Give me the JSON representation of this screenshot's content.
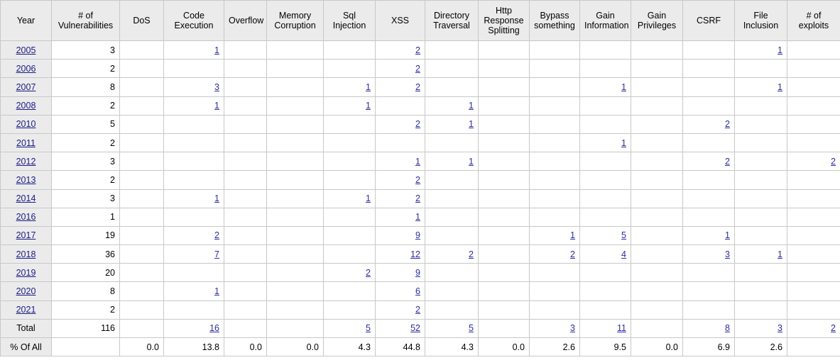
{
  "table": {
    "columns": [
      "Year",
      "# of Vulnerabilities",
      "DoS",
      "Code Execution",
      "Overflow",
      "Memory Corruption",
      "Sql Injection",
      "XSS",
      "Directory Traversal",
      "Http Response Splitting",
      "Bypass something",
      "Gain Information",
      "Gain Privileges",
      "CSRF",
      "File Inclusion",
      "# of exploits"
    ],
    "total_label": "Total",
    "percent_label": "% Of All",
    "link_color": "#2a2ab0",
    "year_link_color": "#1a1a8c",
    "header_bg": "#ebebeb",
    "border_color": "#c8c8c8",
    "rows": [
      {
        "year": "2005",
        "year_link": true,
        "cells": [
          "3",
          "",
          "1",
          "",
          "",
          "",
          "2",
          "",
          "",
          "",
          "",
          "",
          "",
          "1",
          ""
        ],
        "link_flags": [
          false,
          false,
          true,
          false,
          false,
          false,
          true,
          false,
          false,
          false,
          false,
          false,
          false,
          true,
          false
        ]
      },
      {
        "year": "2006",
        "year_link": true,
        "cells": [
          "2",
          "",
          "",
          "",
          "",
          "",
          "2",
          "",
          "",
          "",
          "",
          "",
          "",
          "",
          ""
        ],
        "link_flags": [
          false,
          false,
          false,
          false,
          false,
          false,
          true,
          false,
          false,
          false,
          false,
          false,
          false,
          false,
          false
        ]
      },
      {
        "year": "2007",
        "year_link": true,
        "cells": [
          "8",
          "",
          "3",
          "",
          "",
          "1",
          "2",
          "",
          "",
          "",
          "1",
          "",
          "",
          "1",
          ""
        ],
        "link_flags": [
          false,
          false,
          true,
          false,
          false,
          true,
          true,
          false,
          false,
          false,
          true,
          false,
          false,
          true,
          false
        ]
      },
      {
        "year": "2008",
        "year_link": true,
        "cells": [
          "2",
          "",
          "1",
          "",
          "",
          "1",
          "",
          "1",
          "",
          "",
          "",
          "",
          "",
          "",
          ""
        ],
        "link_flags": [
          false,
          false,
          true,
          false,
          false,
          true,
          false,
          true,
          false,
          false,
          false,
          false,
          false,
          false,
          false
        ]
      },
      {
        "year": "2010",
        "year_link": true,
        "cells": [
          "5",
          "",
          "",
          "",
          "",
          "",
          "2",
          "1",
          "",
          "",
          "",
          "",
          "2",
          "",
          ""
        ],
        "link_flags": [
          false,
          false,
          false,
          false,
          false,
          false,
          true,
          true,
          false,
          false,
          false,
          false,
          true,
          false,
          false
        ]
      },
      {
        "year": "2011",
        "year_link": true,
        "cells": [
          "2",
          "",
          "",
          "",
          "",
          "",
          "",
          "",
          "",
          "",
          "1",
          "",
          "",
          "",
          ""
        ],
        "link_flags": [
          false,
          false,
          false,
          false,
          false,
          false,
          false,
          false,
          false,
          false,
          true,
          false,
          false,
          false,
          false
        ]
      },
      {
        "year": "2012",
        "year_link": true,
        "cells": [
          "3",
          "",
          "",
          "",
          "",
          "",
          "1",
          "1",
          "",
          "",
          "",
          "",
          "2",
          "",
          "2"
        ],
        "link_flags": [
          false,
          false,
          false,
          false,
          false,
          false,
          true,
          true,
          false,
          false,
          false,
          false,
          true,
          false,
          true
        ]
      },
      {
        "year": "2013",
        "year_link": true,
        "cells": [
          "2",
          "",
          "",
          "",
          "",
          "",
          "2",
          "",
          "",
          "",
          "",
          "",
          "",
          "",
          ""
        ],
        "link_flags": [
          false,
          false,
          false,
          false,
          false,
          false,
          true,
          false,
          false,
          false,
          false,
          false,
          false,
          false,
          false
        ]
      },
      {
        "year": "2014",
        "year_link": true,
        "cells": [
          "3",
          "",
          "1",
          "",
          "",
          "1",
          "2",
          "",
          "",
          "",
          "",
          "",
          "",
          "",
          ""
        ],
        "link_flags": [
          false,
          false,
          true,
          false,
          false,
          true,
          true,
          false,
          false,
          false,
          false,
          false,
          false,
          false,
          false
        ]
      },
      {
        "year": "2016",
        "year_link": true,
        "cells": [
          "1",
          "",
          "",
          "",
          "",
          "",
          "1",
          "",
          "",
          "",
          "",
          "",
          "",
          "",
          ""
        ],
        "link_flags": [
          false,
          false,
          false,
          false,
          false,
          false,
          true,
          false,
          false,
          false,
          false,
          false,
          false,
          false,
          false
        ]
      },
      {
        "year": "2017",
        "year_link": true,
        "cells": [
          "19",
          "",
          "2",
          "",
          "",
          "",
          "9",
          "",
          "",
          "1",
          "5",
          "",
          "1",
          "",
          ""
        ],
        "link_flags": [
          false,
          false,
          true,
          false,
          false,
          false,
          true,
          false,
          false,
          true,
          true,
          false,
          true,
          false,
          false
        ]
      },
      {
        "year": "2018",
        "year_link": true,
        "cells": [
          "36",
          "",
          "7",
          "",
          "",
          "",
          "12",
          "2",
          "",
          "2",
          "4",
          "",
          "3",
          "1",
          ""
        ],
        "link_flags": [
          false,
          false,
          true,
          false,
          false,
          false,
          true,
          true,
          false,
          true,
          true,
          false,
          true,
          true,
          false
        ]
      },
      {
        "year": "2019",
        "year_link": true,
        "cells": [
          "20",
          "",
          "",
          "",
          "",
          "2",
          "9",
          "",
          "",
          "",
          "",
          "",
          "",
          "",
          ""
        ],
        "link_flags": [
          false,
          false,
          false,
          false,
          false,
          true,
          true,
          false,
          false,
          false,
          false,
          false,
          false,
          false,
          false
        ]
      },
      {
        "year": "2020",
        "year_link": true,
        "cells": [
          "8",
          "",
          "1",
          "",
          "",
          "",
          "6",
          "",
          "",
          "",
          "",
          "",
          "",
          "",
          ""
        ],
        "link_flags": [
          false,
          false,
          true,
          false,
          false,
          false,
          true,
          false,
          false,
          false,
          false,
          false,
          false,
          false,
          false
        ]
      },
      {
        "year": "2021",
        "year_link": true,
        "cells": [
          "2",
          "",
          "",
          "",
          "",
          "",
          "2",
          "",
          "",
          "",
          "",
          "",
          "",
          "",
          ""
        ],
        "link_flags": [
          false,
          false,
          false,
          false,
          false,
          false,
          true,
          false,
          false,
          false,
          false,
          false,
          false,
          false,
          false
        ]
      },
      {
        "year": "Total",
        "year_link": false,
        "cells": [
          "116",
          "",
          "16",
          "",
          "",
          "5",
          "52",
          "5",
          "",
          "3",
          "11",
          "",
          "8",
          "3",
          "2"
        ],
        "link_flags": [
          false,
          false,
          true,
          false,
          false,
          true,
          true,
          true,
          false,
          true,
          true,
          false,
          true,
          true,
          true
        ]
      },
      {
        "year": "% Of All",
        "year_link": false,
        "cells": [
          "",
          "0.0",
          "13.8",
          "0.0",
          "0.0",
          "4.3",
          "44.8",
          "4.3",
          "0.0",
          "2.6",
          "9.5",
          "0.0",
          "6.9",
          "2.6",
          ""
        ],
        "link_flags": [
          false,
          false,
          false,
          false,
          false,
          false,
          false,
          false,
          false,
          false,
          false,
          false,
          false,
          false,
          false
        ]
      }
    ]
  }
}
